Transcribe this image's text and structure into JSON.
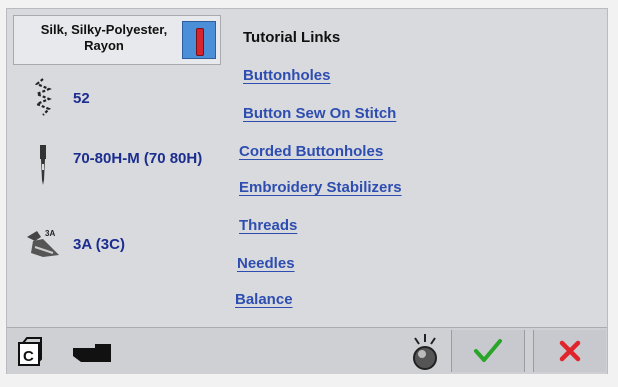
{
  "fabric": {
    "label": "Silk, Silky-Polyester, Rayon",
    "swatch_icon": "needle-red-icon"
  },
  "settings": [
    {
      "icon": "stitch-length-icon",
      "value": "52"
    },
    {
      "icon": "needle-icon",
      "value": "70-80H-M (70 80H)"
    },
    {
      "icon": "presser-foot-icon",
      "value": "3A (3C)"
    }
  ],
  "tutorial": {
    "title": "Tutorial Links",
    "links": [
      "Buttonholes",
      "Button Sew On Stitch",
      "Corded Buttonholes",
      "Embroidery Stabilizers",
      "Threads",
      "Needles",
      "Balance"
    ]
  },
  "bottom_bar": {
    "icons": [
      "c-card-icon",
      "hand-pointer-icon",
      "sound-knob-icon",
      "checkmark-icon",
      "close-x-icon"
    ]
  },
  "colors": {
    "link": "#2e4db0",
    "value": "#1b2d8f",
    "ok": "#2aa52a",
    "cancel": "#e0242c"
  }
}
